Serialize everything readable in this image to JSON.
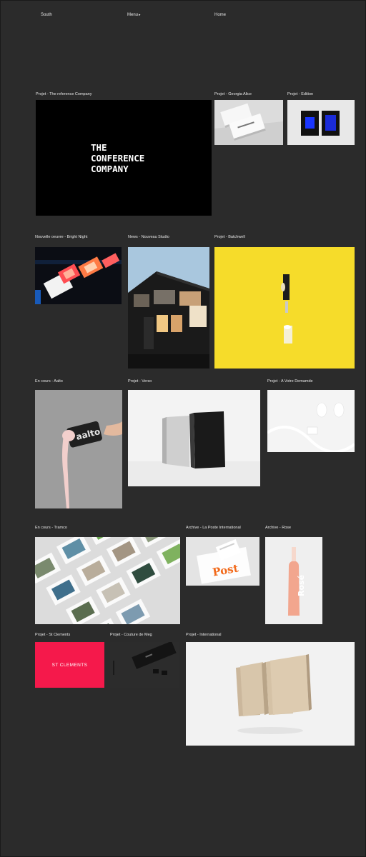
{
  "nav": {
    "brand": "South",
    "menu_label": "Menu",
    "menu_caret": "▸",
    "home_label": "Home"
  },
  "projects": [
    {
      "caption": "Projet - The reference Company",
      "image_text": [
        "THE",
        "CONFERENCE",
        "COMPANY"
      ]
    },
    {
      "caption": "Projet - Georgia Alice"
    },
    {
      "caption": "Projet - Edition"
    },
    {
      "caption": "Nouvelle oeuvre - Bright Night"
    },
    {
      "caption": "News - Nouveau Studio"
    },
    {
      "caption": "Projet - Batchwell"
    },
    {
      "caption": "En cours - Aalto",
      "image_text": "aalto"
    },
    {
      "caption": "Projet - Verso"
    },
    {
      "caption": "Projet - A Votre Demamde"
    },
    {
      "caption": "En cours - Tramco"
    },
    {
      "caption": "Archive - La Poste International",
      "image_text": "Post"
    },
    {
      "caption": "Archive - Rose",
      "image_text": "Rosé"
    },
    {
      "caption": "Projet - St Clements",
      "image_text": "ST CLEMENTS"
    },
    {
      "caption": "Projet - Couture de Meg"
    },
    {
      "caption": "Projet - International"
    }
  ],
  "colors": {
    "page_bg": "#2b2b2b",
    "conference_bg": "#000000",
    "batchwell_yellow": "#f6dc2a",
    "st_clements_red": "#f5194b",
    "post_orange": "#f26a1b",
    "rose_pink": "#f2a68e"
  }
}
